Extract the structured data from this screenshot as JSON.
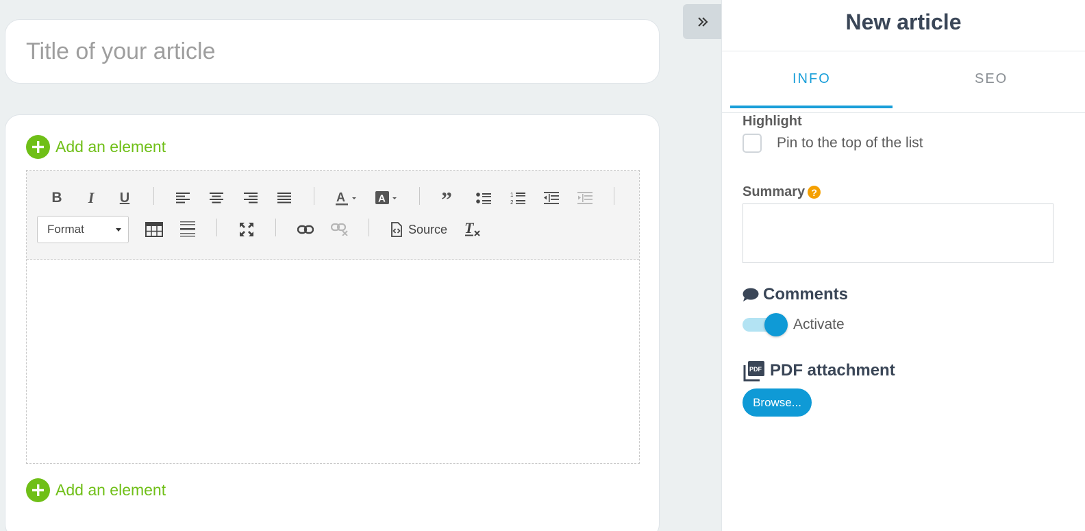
{
  "editor": {
    "title_placeholder": "Title of your article",
    "add_element_label": "Add an element",
    "toolbar": {
      "bold": "B",
      "italic": "I",
      "underline": "U",
      "format_label": "Format",
      "source_label": "Source"
    }
  },
  "panel": {
    "title": "New article",
    "tabs": [
      {
        "label": "INFO",
        "active": true
      },
      {
        "label": "SEO",
        "active": false
      }
    ],
    "highlight": {
      "label": "Highlight",
      "checkbox_label": "Pin to the top of the list",
      "checked": false
    },
    "summary": {
      "label": "Summary",
      "help": "?",
      "value": ""
    },
    "comments": {
      "label": "Comments",
      "toggle_label": "Activate",
      "enabled": true
    },
    "pdf": {
      "label": "PDF attachment",
      "icon_text": "PDF",
      "browse_label": "Browse..."
    }
  },
  "colors": {
    "accent_blue": "#0f9ad6",
    "add_green": "#6fbf17",
    "help_orange": "#f5a000",
    "heading_dark": "#3a4657"
  },
  "icons": {
    "collapse": "double-chevron-right-icon",
    "add": "plus-circle-icon",
    "comments": "speech-bubble-icon",
    "pdf": "pdf-file-icon"
  }
}
